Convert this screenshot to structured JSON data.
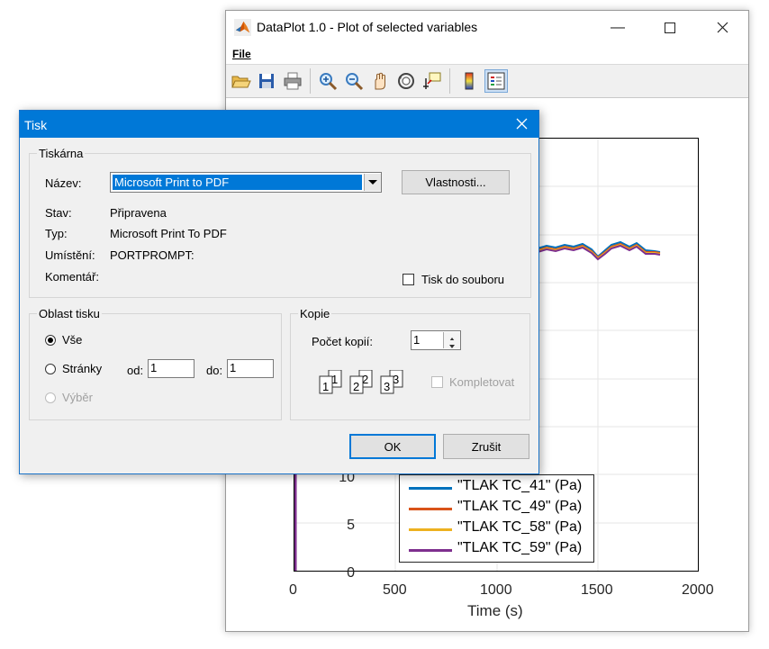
{
  "dataplot": {
    "title": "DataPlot 1.0 - Plot of selected variables",
    "menu_file": "File"
  },
  "plot": {
    "x_ticks": [
      "0",
      "500",
      "1000",
      "1500",
      "2000"
    ],
    "y_ticks": [
      "0",
      "5",
      "10"
    ],
    "xlabel": "Time (s)",
    "legend": [
      {
        "label": "\"TLAK TC_41\" (Pa)",
        "color": "#0072bd"
      },
      {
        "label": "\"TLAK TC_49\" (Pa)",
        "color": "#d95319"
      },
      {
        "label": "\"TLAK TC_58\" (Pa)",
        "color": "#edb120"
      },
      {
        "label": "\"TLAK TC_59\" (Pa)",
        "color": "#7e2f8e"
      }
    ]
  },
  "dialog": {
    "title": "Tisk",
    "printer_group": "Tiskárna",
    "name_label": "Název:",
    "name_value": "Microsoft Print to PDF",
    "properties_button": "Vlastnosti...",
    "status_label": "Stav:",
    "status_value": "Připravena",
    "type_label": "Typ:",
    "type_value": "Microsoft Print To PDF",
    "location_label": "Umístění:",
    "location_value": "PORTPROMPT:",
    "comment_label": "Komentář:",
    "print_to_file": "Tisk do souboru",
    "range_group": "Oblast tisku",
    "all_label": "Vše",
    "pages_label": "Stránky",
    "from_label": "od:",
    "from_value": "1",
    "to_label": "do:",
    "to_value": "1",
    "selection_label": "Výběr",
    "copies_group": "Kopie",
    "copies_label": "Počet kopií:",
    "copies_value": "1",
    "collate_label": "Kompletovat",
    "ok_button": "OK",
    "cancel_button": "Zrušit"
  }
}
